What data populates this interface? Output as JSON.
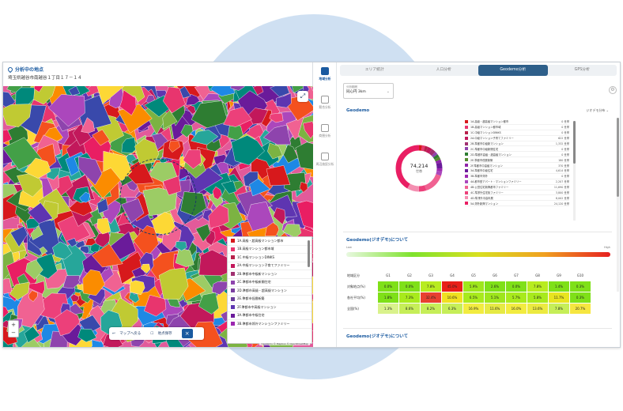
{
  "left": {
    "heading": "分析中の地点",
    "address": "埼玉県越谷市南越谷１丁目１７－１４",
    "legend": [
      {
        "label": "1A.高級・超高級マンション都市",
        "color": "#d7191c"
      },
      {
        "label": "1B.高級マンション都市域",
        "color": "#e8356e"
      },
      {
        "label": "1C.中級マンションDINKS",
        "color": "#b8204a"
      },
      {
        "label": "2A.中級マンション子育てファミリー",
        "color": "#c2185b"
      },
      {
        "label": "2B.準都市中級新マンション",
        "color": "#a03070"
      },
      {
        "label": "2C.準都市中級新開住宅",
        "color": "#8e44ad"
      },
      {
        "label": "2D.準都市高級・超高級マンション",
        "color": "#7b3fa0"
      },
      {
        "label": "2E.準都市低層新築",
        "color": "#6a3d9a"
      },
      {
        "label": "2F.準都市中高級マンション",
        "color": "#5e35b1"
      },
      {
        "label": "3A.準都市中級住宅",
        "color": "#6a1b9a"
      },
      {
        "label": "3B.準都市郊外マンションファミリー",
        "color": "#9c27b0"
      }
    ],
    "map_bar": {
      "back_label": "マップへ戻る",
      "save_label": "地点保存"
    },
    "attribution": "Geodemo © Mapbox © OpenStreetMap"
  },
  "nav": [
    {
      "label": "地域分析",
      "active": true
    },
    {
      "label": "競合分析",
      "active": false
    },
    {
      "label": "商圏分析",
      "active": false
    },
    {
      "label": "周辺施設分析",
      "active": false
    }
  ],
  "right": {
    "tabs": [
      {
        "label": "エリア統計",
        "active": false
      },
      {
        "label": "人口分析",
        "active": false
      },
      {
        "label": "Geodemo分析",
        "active": true
      },
      {
        "label": "GPS分析",
        "active": false
      }
    ],
    "range_select": {
      "label": "分析範囲",
      "value": "同心円 3km"
    },
    "geodemo_title": "Geodemo",
    "view_select": "ジオデモ分布",
    "donut": {
      "total": "74,214",
      "unit": "世帯"
    },
    "segments": [
      {
        "name": "1A.高級・超高級マンション都市",
        "value": "0 世帯",
        "color": "#d7191c",
        "share": 2
      },
      {
        "name": "1B.高級マンション都市域",
        "value": "0 世帯",
        "color": "#e8356e",
        "share": 2
      },
      {
        "name": "1C.中級マンションDINKS",
        "value": "0 世帯",
        "color": "#b8204a",
        "share": 2
      },
      {
        "name": "2A.中級マンション子育てファミリー",
        "value": "622 世帯",
        "color": "#c2185b",
        "share": 3
      },
      {
        "name": "2B.準都市中級新マンション",
        "value": "1,332 世帯",
        "color": "#a03070",
        "share": 3
      },
      {
        "name": "2C.準都市中級新開住宅",
        "value": "0 世帯",
        "color": "#8e44ad",
        "share": 2
      },
      {
        "name": "2D.準都市高級・超高級マンション",
        "value": "0 世帯",
        "color": "#2e7d32",
        "share": 2
      },
      {
        "name": "2E.準都市低層新築",
        "value": "180 世帯",
        "color": "#558b2f",
        "share": 2
      },
      {
        "name": "2F.準都市中高級マンション",
        "value": "370 世帯",
        "color": "#8e24aa",
        "share": 2
      },
      {
        "name": "3A.準都市中級住宅",
        "value": "4,614 世帯",
        "color": "#6a1b9a",
        "share": 4
      },
      {
        "name": "3B.準都市郊外",
        "value": "0 世帯",
        "color": "#9c27b0",
        "share": 2
      },
      {
        "name": "4A.都市型アパート・マンションファミリー",
        "value": "2,207 世帯",
        "color": "#ab47bc",
        "share": 3
      },
      {
        "name": "4B.公営住宅新興都市ファミリー",
        "value": "11,690 世帯",
        "color": "#f06292",
        "share": 14
      },
      {
        "name": "4C.準郊外住宅街ファミリー",
        "value": "3,800 世帯",
        "color": "#ec407a",
        "share": 5
      },
      {
        "name": "4D.準郊外中高年層",
        "value": "8,002 世帯",
        "color": "#f48fb1",
        "share": 8
      },
      {
        "name": "5A.郊外新興マンション",
        "value": "24,120 世帯",
        "color": "#e91e63",
        "share": 40
      }
    ],
    "about_title": "Geodemo(ジオデモ)について",
    "gradient": {
      "low": "Low",
      "high": "High"
    },
    "heat": {
      "header": "地域区分",
      "cols": [
        "G1",
        "G2",
        "G3",
        "G4",
        "G5",
        "G6",
        "G7",
        "G8",
        "G9",
        "G10"
      ],
      "rows": [
        {
          "label": "対象地点(%)",
          "vals": [
            "0.0%",
            "0.0%",
            "7.8%",
            "45.0%",
            "5.9%",
            "2.6%",
            "0.0%",
            "7.8%",
            "1.4%",
            "0.3%"
          ],
          "colors": [
            "#7fe018",
            "#7fe018",
            "#b8ec20",
            "#e82018",
            "#9ee61c",
            "#7fe018",
            "#7fe018",
            "#b8ec20",
            "#7fe018",
            "#7fe018"
          ]
        },
        {
          "label": "各社平均(%)",
          "vals": [
            "1.8%",
            "7.3%",
            "32.4%",
            "10.6%",
            "6.5%",
            "5.1%",
            "5.7%",
            "5.8%",
            "11.7%",
            "0.3%"
          ],
          "colors": [
            "#7fe018",
            "#a8ea1c",
            "#e84030",
            "#f0e020",
            "#a8ea1c",
            "#9ee61c",
            "#a8ea1c",
            "#a8ea1c",
            "#e8e420",
            "#7fe018"
          ]
        },
        {
          "label": "全国(%)",
          "vals": [
            "1.3%",
            "8.6%",
            "8.2%",
            "6.3%",
            "16.9%",
            "11.6%",
            "16.0%",
            "13.6%",
            "7.8%",
            "20.7%"
          ],
          "colors": [
            "#d9f28c",
            "#c6ee58",
            "#c6ee58",
            "#c6ee58",
            "#f2ec40",
            "#e6ea44",
            "#f2ec40",
            "#ecea40",
            "#c6ee58",
            "#f6e640"
          ]
        }
      ]
    },
    "about_title2": "Geodemo(ジオデモ)について"
  }
}
